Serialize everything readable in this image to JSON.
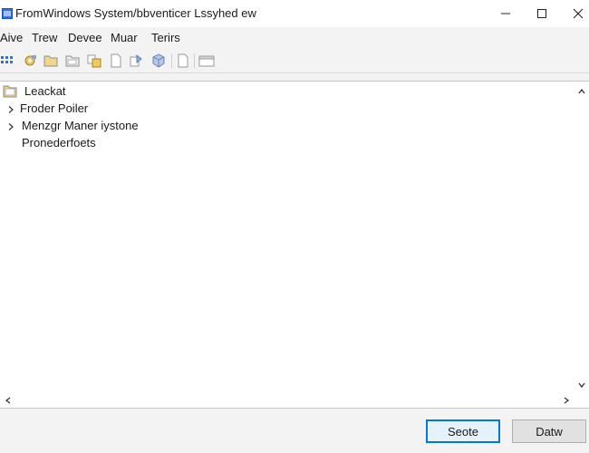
{
  "window": {
    "title": "FromWindows System/bbventicer Lssyhed ew"
  },
  "menu": [
    {
      "label": "Aive"
    },
    {
      "label": "Trew"
    },
    {
      "label": "Devee"
    },
    {
      "label": "Muar"
    },
    {
      "label": "Terirs"
    }
  ],
  "toolbar": {
    "icons": [
      "view-list-icon",
      "properties-icon",
      "folder-icon",
      "folder-open-icon",
      "copy-folder-icon",
      "new-page-icon",
      "export-icon",
      "cube-icon",
      "blank-page-icon",
      "window-icon"
    ]
  },
  "tree": {
    "root": {
      "label": "Leackat",
      "icon": "folder-icon"
    },
    "children": [
      {
        "label": "Froder Poiler",
        "expandable": true
      },
      {
        "label": "Menzgr Maner iystone",
        "expandable": true
      },
      {
        "label": "Pronederfoets",
        "expandable": false
      }
    ]
  },
  "buttons": {
    "primary": "Seote",
    "secondary": "Datw"
  },
  "colors": {
    "accent": "#0078d7",
    "folder": "#e8c15a",
    "titlebar": "#ffffff",
    "chrome": "#f3f3f3"
  }
}
